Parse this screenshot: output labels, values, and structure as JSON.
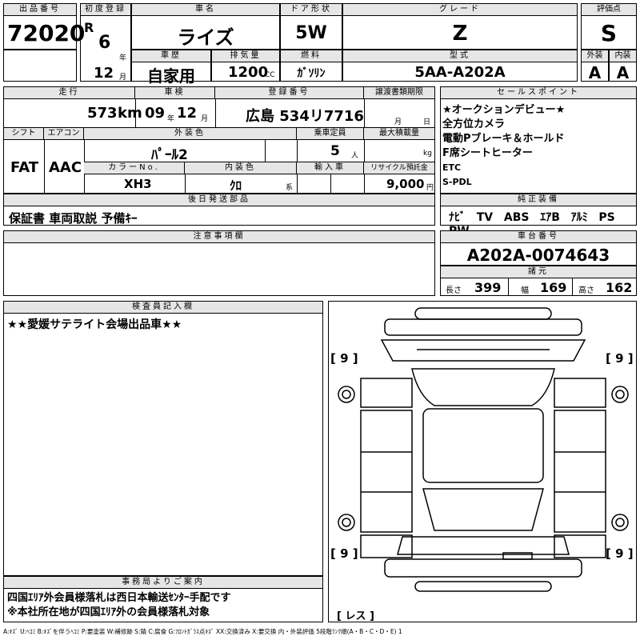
{
  "header": {
    "lot_label": "出品番号",
    "lot_no": "72020",
    "first_reg_label": "初度登録",
    "era": "R",
    "year": "6",
    "year_unit": "年",
    "month": "12",
    "month_unit": "月",
    "car_name_label": "車名",
    "car_name": "ライズ",
    "door_label": "ドア形状",
    "door": "5W",
    "grade_label": "グレード",
    "grade": "Z",
    "rating_label": "評価点",
    "rating": "S",
    "history_label": "車歴",
    "history": "自家用",
    "displacement_label": "排気量",
    "displacement": "1200",
    "displacement_unit": "CC",
    "fuel_label": "燃料",
    "fuel": "ｶﾞｿﾘﾝ",
    "model_label": "型式",
    "model": "5AA-A202A",
    "ext_label": "外装",
    "ext": "A",
    "int_label": "内装",
    "int": "A"
  },
  "row2": {
    "mileage_label": "走行",
    "mileage": "573",
    "mileage_unit": "km",
    "inspection_label": "車検",
    "insp_year": "09",
    "insp_year_unit": "年",
    "insp_month": "12",
    "insp_month_unit": "月",
    "reg_label": "登録番号",
    "reg_no": "広島 534リ7716",
    "transfer_label": "譲渡書類期限",
    "transfer_month": "月",
    "transfer_day": "日",
    "shift_label": "シフト",
    "shift": "FAT",
    "ac_label": "エアコン",
    "ac": "AAC",
    "color_label": "外装色",
    "color": "ﾊﾟｰﾙ2",
    "capacity_label": "乗車定員",
    "capacity": "5",
    "capacity_unit": "人",
    "load_label": "最大積載量",
    "load_unit": "kg",
    "color_no_label": "カラーNo.",
    "color_no": "XH3",
    "int_color_label": "内装色",
    "int_color": "ｸﾛ",
    "int_color_unit": "系",
    "import_label": "輸入車",
    "recycle_label": "リサイクル預託金",
    "recycle": "9,000",
    "recycle_unit": "円",
    "later_label": "後日発送部品",
    "later": "保証書 車両取説 予備ｷｰ"
  },
  "sales": {
    "label": "セールスポイント",
    "lines": [
      "★オークションデビュー★",
      "全方位カメラ",
      "電動Pブレーキ＆ホールド",
      "F席シートヒーター",
      "ETC",
      "S-PDL"
    ]
  },
  "equip": {
    "label": "純正装備",
    "items": [
      "ﾅﾋﾞ",
      "TV",
      "ABS",
      "ｴｱB",
      "ｱﾙﾐ",
      "PS",
      "PW"
    ]
  },
  "notes": {
    "label": "注意事項欄"
  },
  "chassis": {
    "label": "車台番号",
    "value": "A202A-0074643"
  },
  "dims": {
    "label": "諸元",
    "len_label": "長さ",
    "len": "399",
    "wid_label": "幅",
    "wid": "169",
    "hgt_label": "高さ",
    "hgt": "162"
  },
  "inspector": {
    "label": "検査員記入欄",
    "text": "★★愛媛サテライト会場出品車★★"
  },
  "diagram": {
    "marks": [
      "[ 9 ]",
      "[ 9 ]",
      "[ 9 ]",
      "[ 9 ]"
    ],
    "les": "[ レス ]"
  },
  "office": {
    "label": "事務局よりご案内",
    "line1": "四国ｴﾘｱ外会員様落札は西日本輸送ｾﾝﾀｰ手配です",
    "line2": "※本社所在地が四国ｴﾘｱ外の会員様落札対象"
  },
  "legend": "A:ｷｽﾞ U:ﾍｺﾐ B:ｷｽﾞを伴うﾍｺﾐ P:要塗装 W:補修跡 S:錆 C:腐食 G:ﾌﾛﾝﾄｶﾞﾗｽ点ｷｽﾞ XX:交換済み X:要交換 内・外装評価 5段階ﾗﾝｸ順(A・B・C・D・E) 1",
  "colors": {
    "header_bg": "#e6e6e6",
    "line": "#000000"
  }
}
